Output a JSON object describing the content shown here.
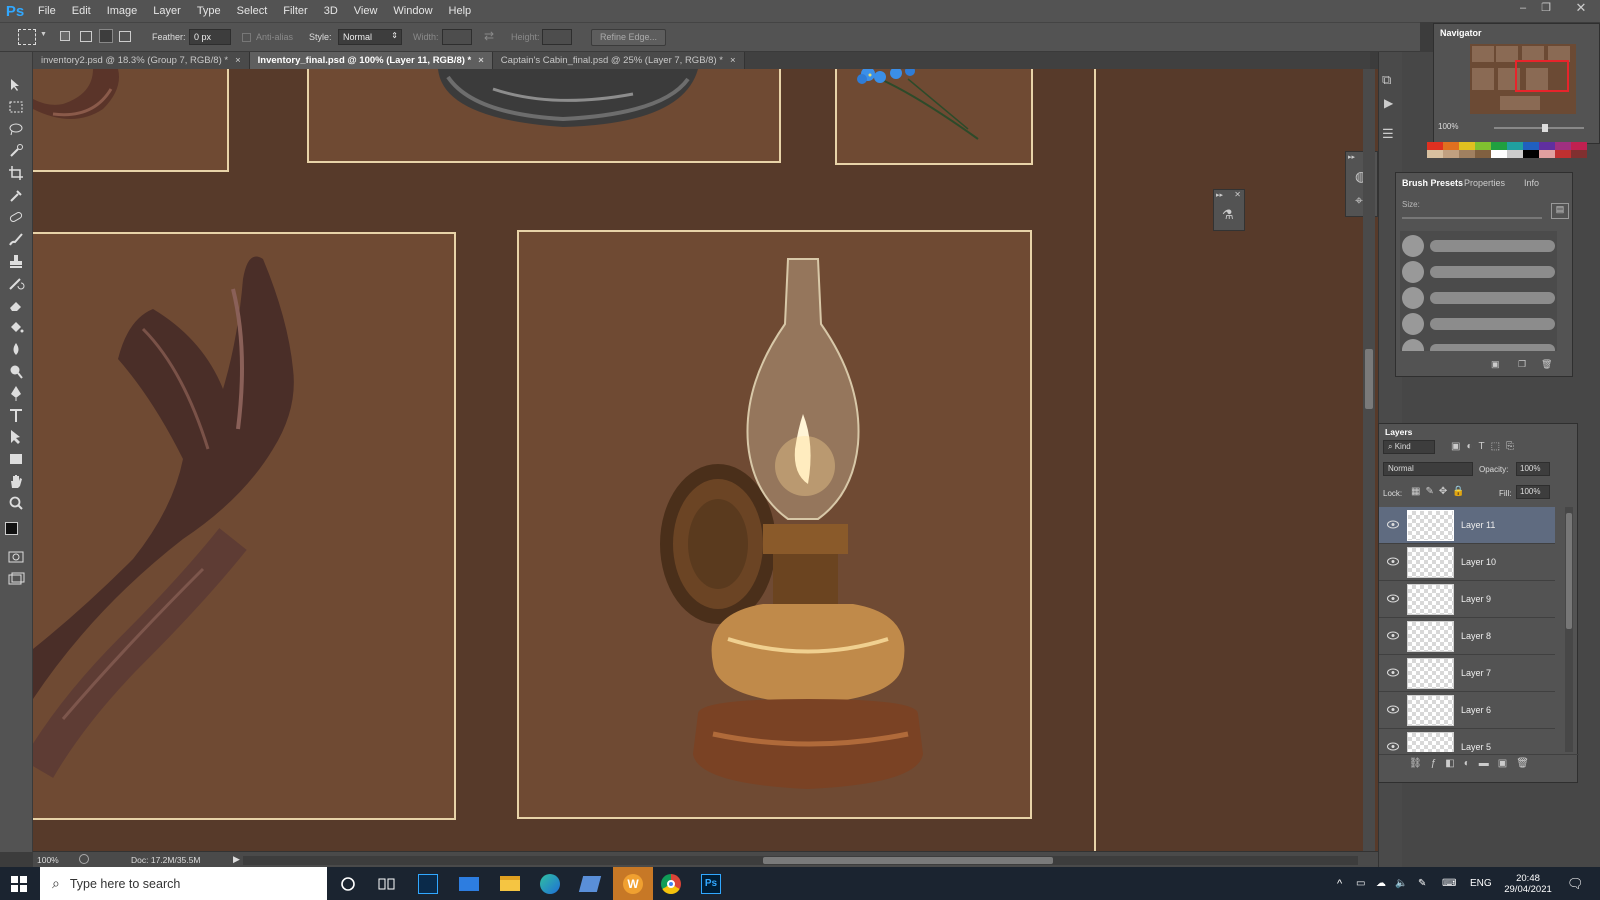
{
  "app": {
    "logo": "Ps"
  },
  "menu": [
    "File",
    "Edit",
    "Image",
    "Layer",
    "Type",
    "Select",
    "Filter",
    "3D",
    "View",
    "Window",
    "Help"
  ],
  "options": {
    "feather_label": "Feather:",
    "feather_value": "0 px",
    "antialias_label": "Anti-alias",
    "style_label": "Style:",
    "style_value": "Normal",
    "width_label": "Width:",
    "height_label": "Height:",
    "refine_edge": "Refine Edge..."
  },
  "tabs": [
    {
      "label": "inventory2.psd @ 18.3% (Group 7, RGB/8) *",
      "active": false
    },
    {
      "label": "Inventory_final.psd @ 100% (Layer 11, RGB/8) *",
      "active": true
    },
    {
      "label": "Captain's Cabin_final.psd @ 25% (Layer 7, RGB/8) *",
      "active": false
    }
  ],
  "tab_close": "×",
  "status": {
    "zoom": "100%",
    "doc": "Doc: 17.2M/35.5M"
  },
  "navigator": {
    "title": "Navigator",
    "zoom": "100%"
  },
  "brush_panel": {
    "tabs": [
      "Brush Presets",
      "Properties",
      "Info"
    ],
    "size_label": "Size:"
  },
  "layers_panel": {
    "title": "Layers",
    "kind_label": "Kind",
    "blend_mode": "Normal",
    "opacity_label": "Opacity:",
    "opacity_value": "100%",
    "lock_label": "Lock:",
    "fill_label": "Fill:",
    "fill_value": "100%",
    "layers": [
      {
        "name": "Layer 11",
        "selected": true
      },
      {
        "name": "Layer 10",
        "selected": false
      },
      {
        "name": "Layer 9",
        "selected": false
      },
      {
        "name": "Layer 8",
        "selected": false
      },
      {
        "name": "Layer 7",
        "selected": false
      },
      {
        "name": "Layer 6",
        "selected": false
      },
      {
        "name": "Layer 5",
        "selected": false
      }
    ]
  },
  "taskbar": {
    "search_placeholder": "Type here to search",
    "language": "ENG",
    "time": "20:48",
    "date": "29/04/2021"
  },
  "colors": {
    "canvas_bg": "#573a2a",
    "cell_bg": "#6f4a33",
    "cell_border": "#e8d3a8",
    "accent": "#31a8ff"
  }
}
